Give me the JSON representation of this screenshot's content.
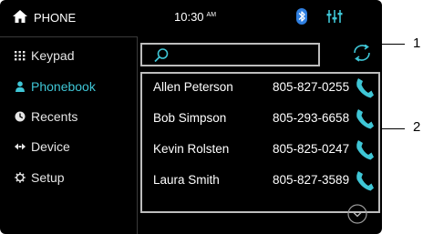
{
  "header": {
    "app_title": "PHONE",
    "time": "10:30",
    "ampm": "AM"
  },
  "sidebar": {
    "items": [
      {
        "label": "Keypad"
      },
      {
        "label": "Phonebook"
      },
      {
        "label": "Recents"
      },
      {
        "label": "Device"
      },
      {
        "label": "Setup"
      }
    ]
  },
  "search": {
    "value": ""
  },
  "contacts": [
    {
      "name": "Allen Peterson",
      "phone": "805-827-0255"
    },
    {
      "name": "Bob Simpson",
      "phone": "805-293-6658"
    },
    {
      "name": "Kevin Rolsten",
      "phone": "805-825-0247"
    },
    {
      "name": "Laura Smith",
      "phone": "805-827-3589"
    }
  ],
  "callouts": {
    "one": "1",
    "two": "2"
  },
  "colors": {
    "accent": "#3fc6d6",
    "bluetooth": "#2f7fe0",
    "background": "#000000"
  }
}
